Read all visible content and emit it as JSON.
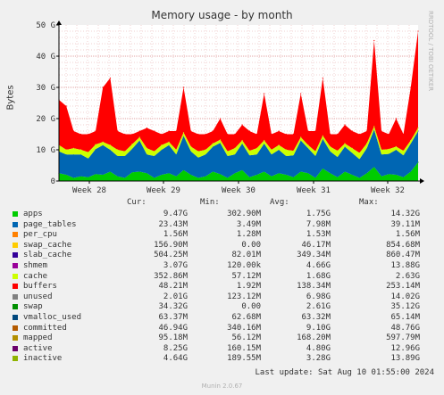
{
  "header": {
    "title": "Memory usage - by month",
    "side_label": "RRDTOOL / TOBI OETIKER",
    "footer_update": "Last update: Sat Aug 10 01:55:00 2024",
    "footer_version": "Munin 2.0.67"
  },
  "legend": {
    "columns": [
      "Cur:",
      "Min:",
      "Avg:",
      "Max:"
    ],
    "rows": [
      {
        "name": "apps",
        "color": "#00cc00",
        "cur": "9.47G",
        "min": "302.90M",
        "avg": "1.75G",
        "max": "14.32G"
      },
      {
        "name": "page_tables",
        "color": "#0066b3",
        "cur": "23.43M",
        "min": "3.49M",
        "avg": "7.98M",
        "max": "39.11M"
      },
      {
        "name": "per_cpu",
        "color": "#ff8000",
        "cur": "1.56M",
        "min": "1.28M",
        "avg": "1.53M",
        "max": "1.56M"
      },
      {
        "name": "swap_cache",
        "color": "#ffcc00",
        "cur": "156.90M",
        "min": "0.00",
        "avg": "46.17M",
        "max": "854.68M"
      },
      {
        "name": "slab_cache",
        "color": "#330099",
        "cur": "504.25M",
        "min": "82.01M",
        "avg": "349.34M",
        "max": "860.47M"
      },
      {
        "name": "shmem",
        "color": "#990099",
        "cur": "3.07G",
        "min": "120.00k",
        "avg": "4.66G",
        "max": "13.88G"
      },
      {
        "name": "cache",
        "color": "#ccff00",
        "cur": "352.86M",
        "min": "57.12M",
        "avg": "1.68G",
        "max": "2.63G"
      },
      {
        "name": "buffers",
        "color": "#ff0000",
        "cur": "48.21M",
        "min": "1.92M",
        "avg": "138.34M",
        "max": "253.14M"
      },
      {
        "name": "unused",
        "color": "#808080",
        "cur": "2.01G",
        "min": "123.12M",
        "avg": "6.98G",
        "max": "14.02G"
      },
      {
        "name": "swap",
        "color": "#008f00",
        "cur": "34.32G",
        "min": "0.00",
        "avg": "2.61G",
        "max": "35.12G"
      },
      {
        "name": "vmalloc_used",
        "color": "#00487d",
        "cur": "63.37M",
        "min": "62.68M",
        "avg": "63.32M",
        "max": "65.14M"
      },
      {
        "name": "committed",
        "color": "#b35a00",
        "cur": "46.94G",
        "min": "340.16M",
        "avg": "9.10G",
        "max": "48.76G"
      },
      {
        "name": "mapped",
        "color": "#b38f00",
        "cur": "95.18M",
        "min": "56.12M",
        "avg": "168.20M",
        "max": "597.79M"
      },
      {
        "name": "active",
        "color": "#6b006b",
        "cur": "8.25G",
        "min": "160.15M",
        "avg": "4.80G",
        "max": "12.96G"
      },
      {
        "name": "inactive",
        "color": "#8fb300",
        "cur": "4.64G",
        "min": "189.55M",
        "avg": "3.28G",
        "max": "13.89G"
      }
    ]
  },
  "chart_data": {
    "type": "area",
    "title": "Memory usage - by month",
    "ylabel": "Bytes",
    "xlabel": "",
    "ylim": [
      0,
      50
    ],
    "y_unit": "G",
    "y_ticks": [
      "0",
      "10 G",
      "20 G",
      "30 G",
      "40 G",
      "50 G"
    ],
    "x_ticks": [
      "Week 28",
      "Week 29",
      "Week 30",
      "Week 31",
      "Week 32"
    ],
    "grid": true,
    "swatch_colors": [
      "#00cc00",
      "#ff0000",
      "#ccff00",
      "#0066b3",
      "#808080",
      "#b38f00",
      "#b35a00",
      "#008f00"
    ],
    "series": [
      {
        "name": "apps",
        "values": [
          2.5,
          2.0,
          1.0,
          1.5,
          1.2,
          2.2,
          2.0,
          3.0,
          1.5,
          1.0,
          2.8,
          3.0,
          2.5,
          1.0,
          2.0,
          2.5,
          1.5,
          3.5,
          2.0,
          1.0,
          1.5,
          3.0,
          2.2,
          1.0,
          2.5,
          3.5,
          1.2,
          2.0,
          3.0,
          1.5,
          2.5,
          2.0,
          1.2,
          3.0,
          2.5,
          1.0,
          4.0,
          2.5,
          1.2,
          3.0,
          2.0,
          1.0,
          2.5,
          4.5,
          1.5,
          2.2,
          2.0,
          1.2,
          3.0,
          6.0
        ]
      },
      {
        "name": "swap",
        "values": [
          7.0,
          6.5,
          7.5,
          7.0,
          6.0,
          8.0,
          9.5,
          7.0,
          6.5,
          7.0,
          7.5,
          10.0,
          6.0,
          7.0,
          8.0,
          9.0,
          7.0,
          11.0,
          7.5,
          6.5,
          7.0,
          8.0,
          10.0,
          7.0,
          6.0,
          8.5,
          7.0,
          6.5,
          9.0,
          7.0,
          7.5,
          6.0,
          7.0,
          10.0,
          8.0,
          7.0,
          9.5,
          7.0,
          6.5,
          8.0,
          7.0,
          6.0,
          8.0,
          12.0,
          7.0,
          6.5,
          8.0,
          7.0,
          9.0,
          10.0
        ]
      },
      {
        "name": "cache",
        "values": [
          2.0,
          1.5,
          2.0,
          1.5,
          2.0,
          1.5,
          1.0,
          1.5,
          2.0,
          1.5,
          1.5,
          1.0,
          2.0,
          1.5,
          1.5,
          1.0,
          1.5,
          1.0,
          1.5,
          2.0,
          1.5,
          1.0,
          1.0,
          1.5,
          2.0,
          1.0,
          1.5,
          2.0,
          1.0,
          1.5,
          1.5,
          2.0,
          1.5,
          1.0,
          1.0,
          1.5,
          1.0,
          1.5,
          2.0,
          1.0,
          1.5,
          2.0,
          1.5,
          1.0,
          1.5,
          1.5,
          1.0,
          1.5,
          1.0,
          1.0
        ]
      },
      {
        "name": "committed",
        "values": [
          26,
          24,
          16,
          15,
          15,
          16,
          30,
          33,
          16,
          15,
          15,
          16,
          17,
          16,
          15,
          16,
          16,
          30,
          16,
          15,
          15,
          16,
          20,
          15,
          15,
          18,
          16,
          15,
          28,
          15,
          16,
          15,
          15,
          28,
          16,
          16,
          33,
          15,
          15,
          18,
          16,
          15,
          16,
          45,
          16,
          15,
          20,
          15,
          30,
          48
        ]
      }
    ]
  }
}
